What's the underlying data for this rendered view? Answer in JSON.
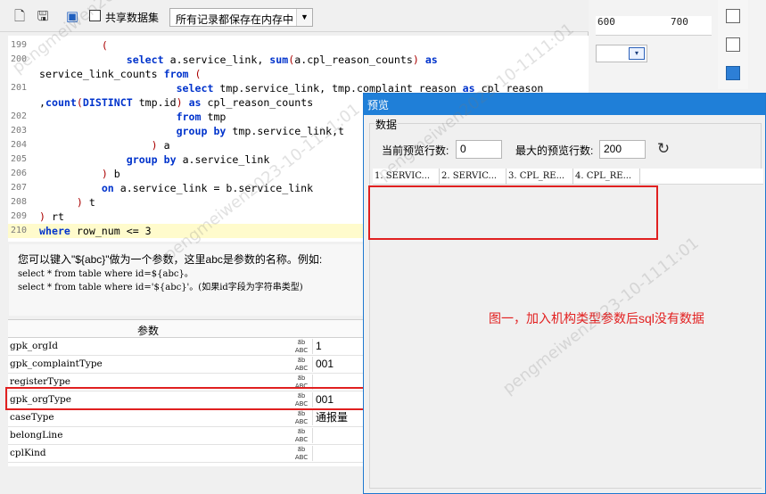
{
  "background_window": {
    "ruler_ticks": [
      "600",
      "700"
    ]
  },
  "toolbar": {
    "share_label": "共享数据集",
    "mode_value": "所有记录都保存在内存中"
  },
  "editor": {
    "lines": [
      {
        "num": "199",
        "text": "          ("
      },
      {
        "num": "200",
        "text": "              select a.service_link, sum(a.cpl_reason_counts) as"
      },
      {
        "num": "",
        "text": "service_link_counts from ("
      },
      {
        "num": "201",
        "text": "                      select tmp.service_link, tmp.complaint_reason as cpl_reason"
      },
      {
        "num": "",
        "text": ",count(DISTINCT tmp.id) as cpl_reason_counts"
      },
      {
        "num": "202",
        "text": "                      from tmp"
      },
      {
        "num": "203",
        "text": "                      group by tmp.service_link,t"
      },
      {
        "num": "204",
        "text": "                  ) a"
      },
      {
        "num": "205",
        "text": "              group by a.service_link"
      },
      {
        "num": "206",
        "text": "          ) b"
      },
      {
        "num": "207",
        "text": "          on a.service_link = b.service_link"
      },
      {
        "num": "208",
        "text": "      ) t"
      },
      {
        "num": "209",
        "text": ") rt"
      },
      {
        "num": "210",
        "text": "where row_num <= 3"
      }
    ]
  },
  "hint": {
    "line1": "您可以键入\"${abc}\"做为一个参数，这里abc是参数的名称。例如:",
    "line2": "select * from table where id=${abc}。",
    "line3": "select * from table where id='${abc}'。(如果id字段为字符串类型)"
  },
  "params": {
    "header": "参数",
    "type_label": "ABC",
    "rows": [
      {
        "name": "gpk_orgId",
        "value": "1"
      },
      {
        "name": "gpk_complaintType",
        "value": "001"
      },
      {
        "name": "registerType",
        "value": ""
      },
      {
        "name": "gpk_orgType",
        "value": "001"
      },
      {
        "name": "caseType",
        "value": "通报量"
      },
      {
        "name": "belongLine",
        "value": ""
      },
      {
        "name": "cplKind",
        "value": ""
      }
    ]
  },
  "preview": {
    "title": "预览",
    "group_label": "数据",
    "current_rows_label": "当前预览行数:",
    "current_rows_value": "0",
    "max_rows_label": "最大的预览行数:",
    "max_rows_value": "200",
    "columns": [
      "1. SERVIC...",
      "2. SERVIC...",
      "3. CPL_RE...",
      "4. CPL_RE..."
    ],
    "annotation": "图一，加入机构类型参数后sql没有数据"
  },
  "watermark": "pengmeiwen2023-10-1111:01",
  "colors": {
    "title_bar": "#1f7fd8",
    "highlight_border": "#e02020",
    "annotation_text": "#e21f1f",
    "keyword": "#0033cc",
    "current_line": "#fffbcc"
  }
}
